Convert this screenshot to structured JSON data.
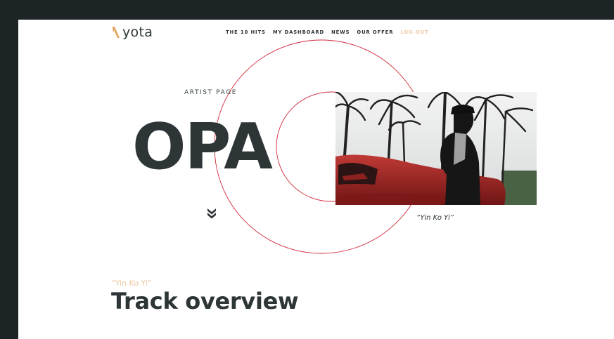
{
  "brand": {
    "name": "yota",
    "accent_color": "#f0c9a4",
    "dark_color": "#2e3537",
    "circle_color": "#d1293a"
  },
  "nav": {
    "items": [
      {
        "label": "THE 10 HITS"
      },
      {
        "label": "MY DASHBOARD"
      },
      {
        "label": "NEWS"
      },
      {
        "label": "OUR OFFER"
      },
      {
        "label": "LOG-OUT"
      }
    ]
  },
  "hero": {
    "eyebrow": "ARTIST PAGE",
    "artist_name": "OPA",
    "scroll_icon": "double-chevron-down-icon",
    "caption": "“Yin Ko Yi”"
  },
  "section": {
    "eyebrow": "“Yin Ko Yi”",
    "title": "Track overview"
  }
}
